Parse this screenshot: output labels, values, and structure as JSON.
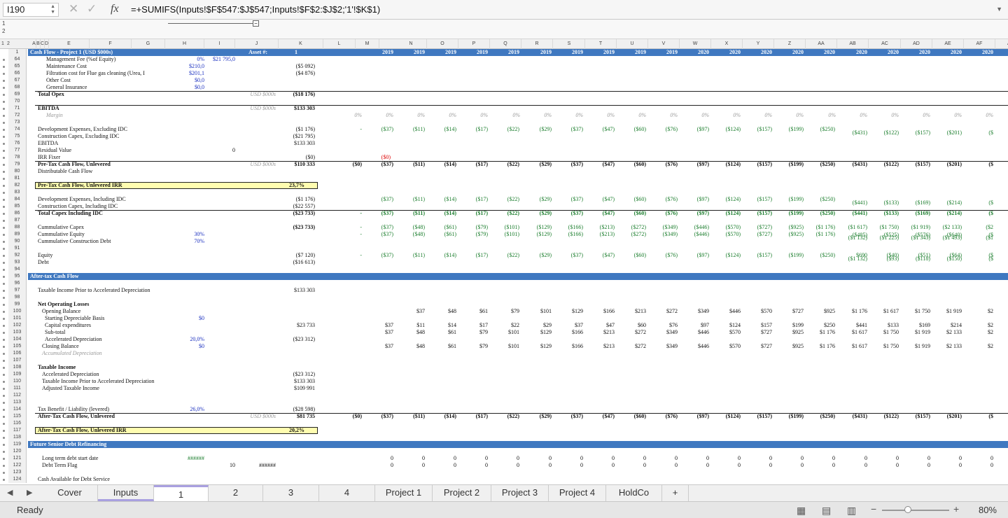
{
  "namebox": "I190",
  "formula": "=+SUMIFS(Inputs!$F$547:$J$547;Inputs!$F$2:$J$2;'1'!$K$1)",
  "outline_levels": [
    "1",
    "2"
  ],
  "outline_cols": [
    "1",
    "2"
  ],
  "col_letters": [
    "A",
    "B",
    "C",
    "D",
    "E",
    "F",
    "G",
    "H",
    "I",
    "J",
    "K",
    "L",
    "M",
    "N",
    "O",
    "P",
    "Q",
    "R",
    "S",
    "T",
    "U",
    "V",
    "W",
    "X",
    "Y",
    "Z",
    "AA",
    "AB",
    "AC",
    "AD",
    "AE",
    "AF",
    "AG"
  ],
  "row_numbers": [
    "1",
    "64",
    "65",
    "66",
    "67",
    "68",
    "69",
    "70",
    "71",
    "72",
    "73",
    "74",
    "75",
    "76",
    "77",
    "78",
    "79",
    "80",
    "81",
    "82",
    "83",
    "84",
    "85",
    "86",
    "87",
    "88",
    "89",
    "90",
    "91",
    "92",
    "93",
    "94",
    "95",
    "96",
    "97",
    "98",
    "99",
    "100",
    "101",
    "102",
    "103",
    "104",
    "105",
    "106",
    "107",
    "108",
    "109",
    "110",
    "111",
    "112",
    "113",
    "114",
    "115",
    "116",
    "117",
    "118",
    "119",
    "120",
    "121",
    "122",
    "123",
    "124"
  ],
  "header": {
    "title": "Cash Flow - Project 1 (USD $000s)",
    "asset_label": "Asset #:",
    "asset_no": "1",
    "years": [
      "2019",
      "2019",
      "2019",
      "2019",
      "2019",
      "2019",
      "2019",
      "2019",
      "2019",
      "2019",
      "2020",
      "2020",
      "2020",
      "2020",
      "2020",
      "2020",
      "2020",
      "2020",
      "2020",
      "2020"
    ]
  },
  "labels": {
    "r64": "Management Fee (%of Equity)",
    "r64h": "0%",
    "r64i": "$21 795,0",
    "r65": "Maintenance Cost",
    "r65h": "$210,0",
    "r65k": "($5 092)",
    "r66": "Filtration cost for Flue gas cleaning (Urea, I",
    "r66h": "$201,1",
    "r66k": "($4 876)",
    "r67": "Other Cost",
    "r67h": "$0,0",
    "r68": "General Insurance",
    "r68h": "$0,0",
    "r69": "Total Opex",
    "r69j": "USD $000s",
    "r69k": "($18 176)",
    "r71": "EBITDA",
    "r71j": "USD $000s",
    "r71k": "$133 303",
    "r72": "Margin",
    "r74": "Development Expenses, Excluding IDC",
    "r74k": "($1 176)",
    "r75": "Construction Capex, Excluding IDC",
    "r75k": "($21 795)",
    "r76": "EBITDA",
    "r76k": "$133 303",
    "r77": "Residual Value",
    "r77i": "0",
    "r78": "IRR Fixer",
    "r78k": "($0)",
    "r79": "Pre-Tax Cash Flow, Unlevered",
    "r79j": "USD $000s",
    "r79k": "$110 333",
    "r80": "Distributable Cash Flow",
    "r82": "Pre-Tax Cash Flow, Unlevered IRR",
    "r82k": "23,7%",
    "r84": "Development Expenses, Including IDC",
    "r84k": "($1 176)",
    "r85": "Construction Capex, Including IDC",
    "r85k": "($22 557)",
    "r86": "Total Capex Including IDC",
    "r86k": "($23 733)",
    "r88": "Cummulative Capex",
    "r88k": "($23 733)",
    "r89": "Cummulative Equity",
    "r89h": "30%",
    "r90": "Cummulative Construction Debt",
    "r90h": "70%",
    "r92": "Equity",
    "r92k": "($7 120)",
    "r93": "Debt",
    "r93k": "($16 613)",
    "r95": "After-tax Cash Flow",
    "r97": "Taxable Income Prior to Accelerated Depreciation",
    "r97k": "$133 303",
    "r99": "Net Operating Losses",
    "r100": "Opening Balance",
    "r101": "Starting Depreciable Basis",
    "r101h": "$0",
    "r102": "Capital expenditures",
    "r102k": "$23 733",
    "r103": "Sub-total",
    "r104": "Accelerated Depreciation",
    "r104h": "20,0%",
    "r104k": "($23 312)",
    "r105": "Closing Balance",
    "r105h": "$0",
    "r106": "Accumulated Depreciation",
    "r108": "Taxable Income",
    "r109": "Accelerated Depreciation",
    "r109k": "($23 312)",
    "r110": "Taxable Income Prior to Accelerated Depreciation",
    "r110k": "$133 303",
    "r111": "Adjusted Taxable Income",
    "r111k": "$109 991",
    "r114": "Tax Benefit / Liability (levered)",
    "r114h": "26,0%",
    "r114k": "($28 598)",
    "r115": "After-Tax Cash Flow, Unlevered",
    "r115j": "USD $000s",
    "r115k": "$81 735",
    "r117": "After-Tax Cash Flow, Unlevered IRR",
    "r117k": "20,2%",
    "r119": "Future Senior Debt Refinancing",
    "r121": "Long term debt start date",
    "r121h": "######",
    "r122": "Debt Term Flag",
    "r122i": "10",
    "r122j": "######",
    "r124": "Cash Available for Debt Service"
  },
  "series": {
    "margin": [
      "0%",
      "0%",
      "0%",
      "0%",
      "0%",
      "0%",
      "0%",
      "0%",
      "0%",
      "0%",
      "0%",
      "0%",
      "0%",
      "0%",
      "0%",
      "0%",
      "0%",
      "0%",
      "0%",
      "0%",
      "0%"
    ],
    "dev74": [
      "-",
      "($37)",
      "($11)",
      "($14)",
      "($17)",
      "($22)",
      "($29)",
      "($37)",
      "($47)",
      "($60)",
      "($76)",
      "($97)",
      "($124)",
      "($157)",
      "($199)",
      "($250)",
      "",
      "",
      "",
      "",
      ""
    ],
    "dev75": [
      "",
      "",
      "",
      "",
      "",
      "",
      "",
      "",
      "",
      "",
      "",
      "",
      "",
      "",
      "",
      "",
      "($431)",
      "($122)",
      "($157)",
      "($201)",
      "($"
    ],
    "fix78": [
      "($0)"
    ],
    "pre79": [
      "($0)",
      "($37)",
      "($11)",
      "($14)",
      "($17)",
      "($22)",
      "($29)",
      "($37)",
      "($47)",
      "($60)",
      "($76)",
      "($97)",
      "($124)",
      "($157)",
      "($199)",
      "($250)",
      "($431)",
      "($122)",
      "($157)",
      "($201)",
      "($"
    ],
    "dev84": [
      "",
      "($37)",
      "($11)",
      "($14)",
      "($17)",
      "($22)",
      "($29)",
      "($37)",
      "($47)",
      "($60)",
      "($76)",
      "($97)",
      "($124)",
      "($157)",
      "($199)",
      "($250)",
      "",
      "",
      "",
      "",
      ""
    ],
    "con85": [
      "",
      "",
      "",
      "",
      "",
      "",
      "",
      "",
      "",
      "",
      "",
      "",
      "",
      "",
      "",
      "",
      "($441)",
      "($133)",
      "($169)",
      "($214)",
      "($"
    ],
    "tot86": [
      "-",
      "($37)",
      "($11)",
      "($14)",
      "($17)",
      "($22)",
      "($29)",
      "($37)",
      "($47)",
      "($60)",
      "($76)",
      "($97)",
      "($124)",
      "($157)",
      "($199)",
      "($250)",
      "($441)",
      "($133)",
      "($169)",
      "($214)",
      "($"
    ],
    "cum88": [
      "-",
      "($37)",
      "($48)",
      "($61)",
      "($79)",
      "($101)",
      "($129)",
      "($166)",
      "($213)",
      "($272)",
      "($349)",
      "($446)",
      "($570)",
      "($727)",
      "($925)",
      "($1 176)",
      "($1 617)",
      "($1 750)",
      "($1 919)",
      "($2 133)",
      "($2"
    ],
    "cum89": [
      "-",
      "($37)",
      "($48)",
      "($61)",
      "($79)",
      "($101)",
      "($129)",
      "($166)",
      "($213)",
      "($272)",
      "($349)",
      "($446)",
      "($570)",
      "($727)",
      "($925)",
      "($1 176)",
      "($485)",
      "($525)",
      "($576)",
      "($640)",
      "($"
    ],
    "cum90": [
      "",
      "",
      "",
      "",
      "",
      "",
      "",
      "",
      "",
      "",
      "",
      "",
      "",
      "",
      "",
      "",
      "($1 132)",
      "($1 225)",
      "($1 343)",
      "($1 493)",
      "($1"
    ],
    "eq92": [
      "-",
      "($37)",
      "($11)",
      "($14)",
      "($17)",
      "($22)",
      "($29)",
      "($37)",
      "($47)",
      "($60)",
      "($76)",
      "($97)",
      "($124)",
      "($157)",
      "($199)",
      "($250)",
      "$690",
      "($40)",
      "($51)",
      "($64)",
      "($"
    ],
    "debt93": [
      "",
      "",
      "",
      "",
      "",
      "",
      "",
      "",
      "",
      "",
      "",
      "",
      "",
      "",
      "",
      "",
      "($1 132)",
      "($93)",
      "($118)",
      "($150)",
      "($"
    ],
    "open100": [
      "",
      "",
      "$37",
      "$48",
      "$61",
      "$79",
      "$101",
      "$129",
      "$166",
      "$213",
      "$272",
      "$349",
      "$446",
      "$570",
      "$727",
      "$925",
      "$1 176",
      "$1 617",
      "$1 750",
      "$1 919",
      "$2"
    ],
    "cap102": [
      "",
      "$37",
      "$11",
      "$14",
      "$17",
      "$22",
      "$29",
      "$37",
      "$47",
      "$60",
      "$76",
      "$97",
      "$124",
      "$157",
      "$199",
      "$250",
      "$441",
      "$133",
      "$169",
      "$214",
      "$2"
    ],
    "sub103": [
      "",
      "$37",
      "$48",
      "$61",
      "$79",
      "$101",
      "$129",
      "$166",
      "$213",
      "$272",
      "$349",
      "$446",
      "$570",
      "$727",
      "$925",
      "$1 176",
      "$1 617",
      "$1 750",
      "$1 919",
      "$2 133",
      "$2"
    ],
    "close105": [
      "",
      "$37",
      "$48",
      "$61",
      "$79",
      "$101",
      "$129",
      "$166",
      "$213",
      "$272",
      "$349",
      "$446",
      "$570",
      "$727",
      "$925",
      "$1 176",
      "$1 617",
      "$1 750",
      "$1 919",
      "$2 133",
      "$2"
    ],
    "at115": [
      "($0)",
      "($37)",
      "($11)",
      "($14)",
      "($17)",
      "($22)",
      "($29)",
      "($37)",
      "($47)",
      "($60)",
      "($76)",
      "($97)",
      "($124)",
      "($157)",
      "($199)",
      "($250)",
      "($431)",
      "($122)",
      "($157)",
      "($201)",
      "($"
    ],
    "flag121": [
      "0",
      "0",
      "0",
      "0",
      "0",
      "0",
      "0",
      "0",
      "0",
      "0",
      "0",
      "0",
      "0",
      "0",
      "0",
      "0",
      "0",
      "0",
      "0",
      "0"
    ],
    "flag122": [
      "0",
      "0",
      "0",
      "0",
      "0",
      "0",
      "0",
      "0",
      "0",
      "0",
      "0",
      "0",
      "0",
      "0",
      "0",
      "0",
      "0",
      "0",
      "0",
      "0"
    ]
  },
  "tabs": [
    {
      "label": "Cover"
    },
    {
      "label": "Inputs"
    },
    {
      "label": "1"
    },
    {
      "label": "2"
    },
    {
      "label": "3"
    },
    {
      "label": "4"
    },
    {
      "label": "Project 1"
    },
    {
      "label": "Project 2"
    },
    {
      "label": "Project 3"
    },
    {
      "label": "Project 4"
    },
    {
      "label": "HoldCo"
    },
    {
      "label": "+"
    }
  ],
  "status": {
    "ready": "Ready",
    "zoom": "80%"
  },
  "colors": {
    "bar": "#3f78c0",
    "highlight": "#fffdb0",
    "green": "#1a7d2c",
    "blue": "#1a2fbf"
  }
}
